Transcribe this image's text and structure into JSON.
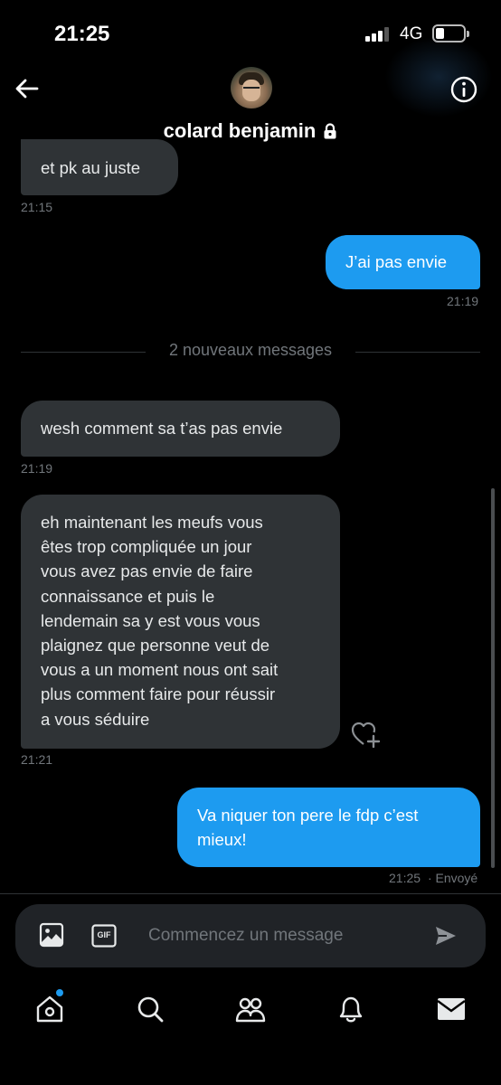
{
  "status_bar": {
    "time": "21:25",
    "network": "4G"
  },
  "header": {
    "contact_name": "colard benjamin"
  },
  "messages": [
    {
      "direction": "in",
      "lines": [
        "et pk au juste"
      ],
      "time": "21:15"
    },
    {
      "direction": "out",
      "lines": [
        "J’ai pas envie"
      ],
      "time": "21:19"
    },
    {
      "direction": "in",
      "lines": [
        "wesh comment sa t’as pas envie"
      ],
      "time": "21:19"
    },
    {
      "direction": "in",
      "lines": [
        "eh maintenant les meufs vous",
        "êtes trop compliquée un jour",
        "vous avez pas envie de faire",
        "connaissance et puis le",
        "lendemain sa y est vous vous",
        "plaignez que personne veut de",
        "vous a un moment nous ont sait",
        "plus comment faire pour réussir",
        "a vous séduire"
      ],
      "time": "21:21"
    },
    {
      "direction": "out",
      "lines": [
        "Va niquer ton pere le fdp c’est",
        "mieux!"
      ],
      "time": "21:25",
      "status": "· Envoyé"
    }
  ],
  "divider": {
    "label": "2 nouveaux messages"
  },
  "composer": {
    "placeholder": "Commencez un message",
    "gif_label": "GIF"
  },
  "nav": {
    "items": [
      {
        "id": "home",
        "icon": "home-icon",
        "has_notification_dot": true
      },
      {
        "id": "search",
        "icon": "search-icon"
      },
      {
        "id": "communities",
        "icon": "people-icon"
      },
      {
        "id": "notifications",
        "icon": "bell-icon"
      },
      {
        "id": "messages",
        "icon": "envelope-icon"
      }
    ]
  },
  "colors": {
    "background": "#000000",
    "incoming_bubble": "#2f3336",
    "outgoing_bubble": "#1d9bf0",
    "secondary_text": "#71767b"
  }
}
